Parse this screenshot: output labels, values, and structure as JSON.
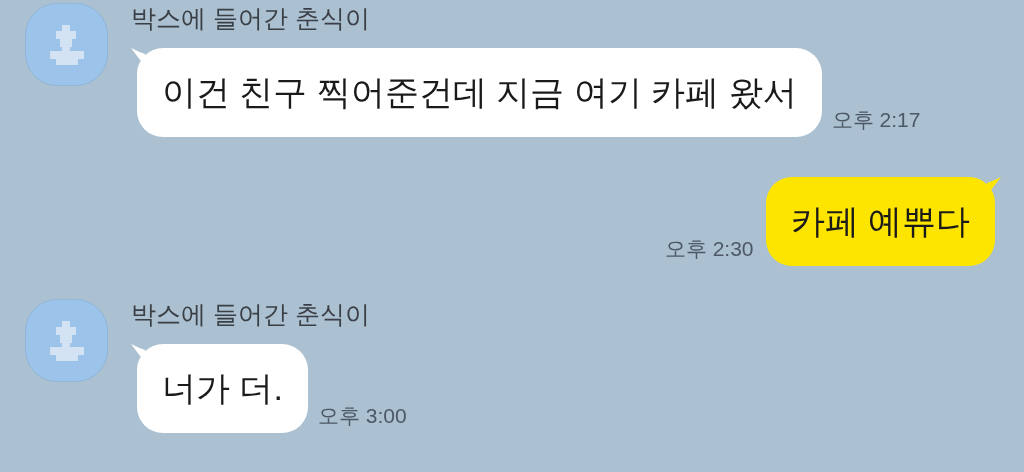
{
  "messages": [
    {
      "kind": "received",
      "sender": "박스에 들어간 춘식이",
      "text": "이건 친구 찍어준건데 지금 여기 카페 왔서",
      "time": "오후 2:17"
    },
    {
      "kind": "sent",
      "text": "카페 예쀼다",
      "time": "오후 2:30"
    },
    {
      "kind": "received",
      "sender": "박스에 들어간 춘식이",
      "text": "너가 더.",
      "time": "오후 3:00"
    }
  ]
}
